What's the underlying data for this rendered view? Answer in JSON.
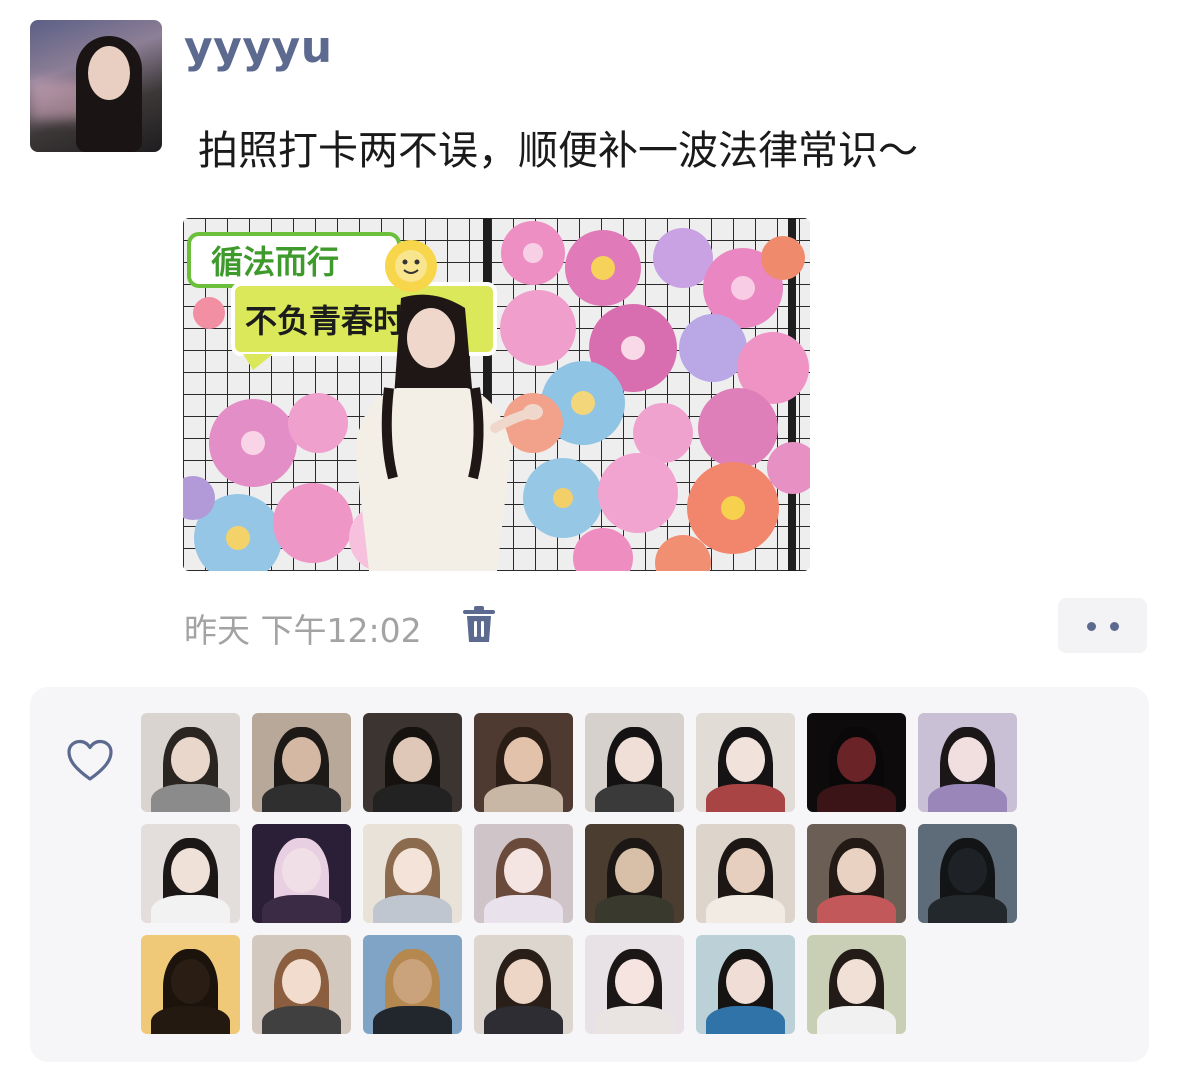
{
  "post": {
    "username": "yyyyu",
    "text": "拍照打卡两不误，顺便补一波法律常识～",
    "photo": {
      "sign_line1": "循法而行",
      "sign_line2": "不负青春时光"
    },
    "timestamp": "昨天 下午12:02"
  },
  "icons": {
    "delete": "trash-icon",
    "more": "more-dots-icon",
    "like": "heart-icon"
  },
  "colors": {
    "username": "#5d6a8f",
    "timestamp": "#a3a3a3",
    "panel": "#f6f6f8"
  },
  "likes": {
    "count": 23,
    "avatars": [
      {
        "bg": "#d9d4cf",
        "face": "#e9d7cc",
        "hair": "#2b2522",
        "body": "#8b8b8b"
      },
      {
        "bg": "#b7a89a",
        "face": "#d4b8a4",
        "hair": "#1d1917",
        "body": "#2f2f2f"
      },
      {
        "bg": "#3b3430",
        "face": "#e0c8b8",
        "hair": "#161210",
        "body": "#222222"
      },
      {
        "bg": "#4e3a30",
        "face": "#e3c2ac",
        "hair": "#2a1d16",
        "body": "#c9b7a6"
      },
      {
        "bg": "#d6d1cc",
        "face": "#efdfd6",
        "hair": "#141212",
        "body": "#3a3a3a"
      },
      {
        "bg": "#e2dcd7",
        "face": "#f2e2dc",
        "hair": "#151313",
        "body": "#a84444"
      },
      {
        "bg": "#0d0b0b",
        "face": "#6a2428",
        "hair": "#0a0808",
        "body": "#3a1416"
      },
      {
        "bg": "#c9c0d6",
        "face": "#f1dfe0",
        "hair": "#1b1719",
        "body": "#9a86b8"
      },
      {
        "bg": "#e3dedb",
        "face": "#efe0d8",
        "hair": "#1b1717",
        "body": "#f2f2f2"
      },
      {
        "bg": "#2a1f36",
        "face": "#f0dfe6",
        "hair": "#e9cfe2",
        "body": "#3b2b45"
      },
      {
        "bg": "#e8e2d9",
        "face": "#f3e3d9",
        "hair": "#8b6a4e",
        "body": "#bfc6cf"
      },
      {
        "bg": "#cfc4c7",
        "face": "#f4e5e2",
        "hair": "#6a4a3a",
        "body": "#e9e1ec"
      },
      {
        "bg": "#4b3d30",
        "face": "#d8bfa8",
        "hair": "#1c1714",
        "body": "#393a2d"
      },
      {
        "bg": "#ddd5cc",
        "face": "#e6cfbf",
        "hair": "#1c1715",
        "body": "#f1ebe4"
      },
      {
        "bg": "#6a5e55",
        "face": "#ead2c3",
        "hair": "#231a15",
        "body": "#c3585a"
      },
      {
        "bg": "#5d6c78",
        "face": "#1e2226",
        "hair": "#121416",
        "body": "#23282d"
      },
      {
        "bg": "#f0c978",
        "face": "#2a1e14",
        "hair": "#1b130c",
        "body": "#231910"
      },
      {
        "bg": "#d2c8bd",
        "face": "#f1dccd",
        "hair": "#8a5e3e",
        "body": "#404040"
      },
      {
        "bg": "#7fa4c6",
        "face": "#caa37c",
        "hair": "#b4884e",
        "body": "#22272d"
      },
      {
        "bg": "#ddd6cf",
        "face": "#edd6c6",
        "hair": "#2a1f18",
        "body": "#2d2d33"
      },
      {
        "bg": "#e8e2e6",
        "face": "#f5e4df",
        "hair": "#1c1717",
        "body": "#e9e4e1"
      },
      {
        "bg": "#bcd0d8",
        "face": "#f0ddd5",
        "hair": "#161313",
        "body": "#2f73a8"
      },
      {
        "bg": "#c8cfb4",
        "face": "#f1e0d5",
        "hair": "#221b18",
        "body": "#f1f1f1"
      }
    ]
  }
}
